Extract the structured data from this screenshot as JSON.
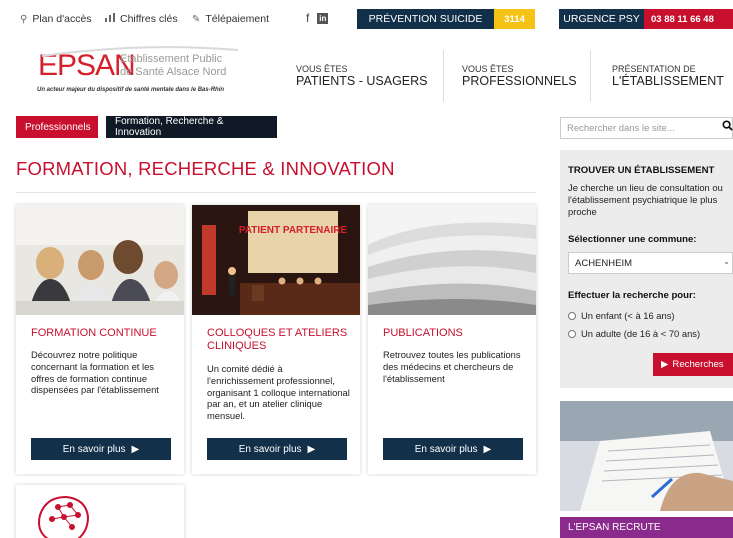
{
  "topbar": {
    "links": [
      {
        "label": "Plan d'accès",
        "icon": "map-pin-icon"
      },
      {
        "label": "Chiffres clés",
        "icon": "bar-chart-icon"
      },
      {
        "label": "Télépaiement",
        "icon": "leaf-icon"
      }
    ],
    "social": [
      "f",
      "in"
    ],
    "prevention_label": "PRÉVENTION SUICIDE",
    "prevention_number": "3114",
    "urgence_label": "URGENCE PSY",
    "urgence_number": "03 88 11 66 48"
  },
  "header": {
    "logo": "EPSAN",
    "logo_sub_1": "Etablissement Public",
    "logo_sub_2": "de Santé Alsace Nord",
    "tagline": "Un acteur majeur du dispositif de santé mentale dans le Bas-Rhin",
    "nav": [
      {
        "small": "VOUS ÊTES",
        "big": "PATIENTS - USAGERS"
      },
      {
        "small": "VOUS ÊTES",
        "big": "PROFESSIONNELS"
      },
      {
        "small": "PRÉSENTATION DE",
        "big": "L'ÉTABLISSEMENT"
      }
    ]
  },
  "breadcrumb": [
    "Professionnels",
    "Formation, Recherche & Innovation"
  ],
  "search": {
    "placeholder": "Rechercher dans le site..."
  },
  "page_title": "FORMATION, RECHERCHE & INNOVATION",
  "cards": [
    {
      "title": "FORMATION CONTINUE",
      "text": "Découvrez notre politique concernant la formation et les offres de formation continue dispensées par l'établissement",
      "button": "En savoir plus"
    },
    {
      "title": "COLLOQUES ET ATELIERS CLINIQUES",
      "text": "Un comité dédié à l'enrichissement professionnel, organisant 1 colloque international par an, et un atelier clinique mensuel.",
      "button": "En savoir plus",
      "image_banner": "PATIENT PARTENAIRE"
    },
    {
      "title": "PUBLICATIONS",
      "text": "Retrouvez toutes les publications des médecins et chercheurs de l'établissement",
      "button": "En savoir plus"
    }
  ],
  "finder": {
    "title": "TROUVER UN ÉTABLISSEMENT",
    "desc": "Je cherche un lieu de consultation ou l'établissement psychiatrique le plus proche",
    "commune_label": "Sélectionner une commune:",
    "commune_value": "ACHENHEIM",
    "search_for_label": "Effectuer la recherche pour:",
    "options": [
      "Un enfant (< à 16 ans)",
      "Un adulte (de 16 à < 70 ans)"
    ],
    "button": "Recherches"
  },
  "recrute": "L'EPSAN RECRUTE",
  "colors": {
    "red": "#c8102e",
    "navy": "#123049",
    "yellow": "#f5c316",
    "purple": "#8a2a8c"
  }
}
